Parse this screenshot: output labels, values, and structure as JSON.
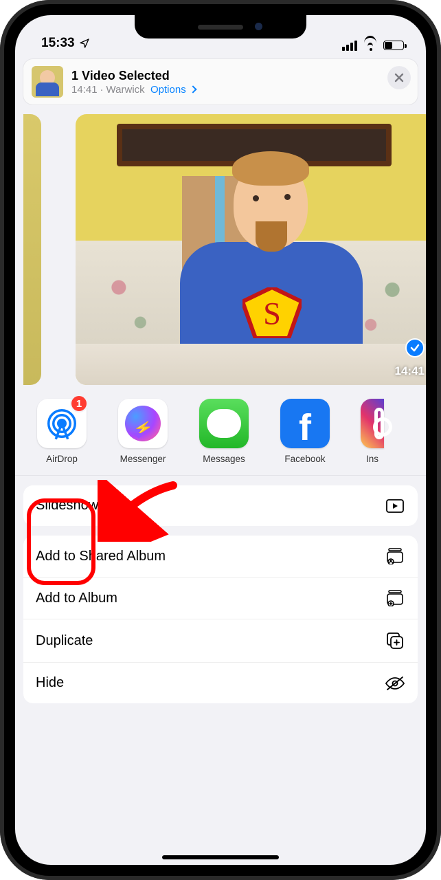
{
  "status": {
    "time": "15:33"
  },
  "header": {
    "title": "1 Video Selected",
    "subtitle_time": "14:41",
    "subtitle_location": "Warwick",
    "options_label": "Options"
  },
  "preview": {
    "duration": "14:41",
    "selected": true
  },
  "apps": {
    "airdrop": {
      "label": "AirDrop",
      "badge": "1"
    },
    "messenger": {
      "label": "Messenger"
    },
    "messages": {
      "label": "Messages"
    },
    "facebook": {
      "label": "Facebook"
    },
    "instagram": {
      "label": "Ins"
    }
  },
  "actions": {
    "slideshow": "Slideshow",
    "add_shared": "Add to Shared Album",
    "add_album": "Add to Album",
    "duplicate": "Duplicate",
    "hide": "Hide"
  },
  "annotation": {
    "highlight_target": "airdrop",
    "arrow_color": "#ff0000"
  }
}
